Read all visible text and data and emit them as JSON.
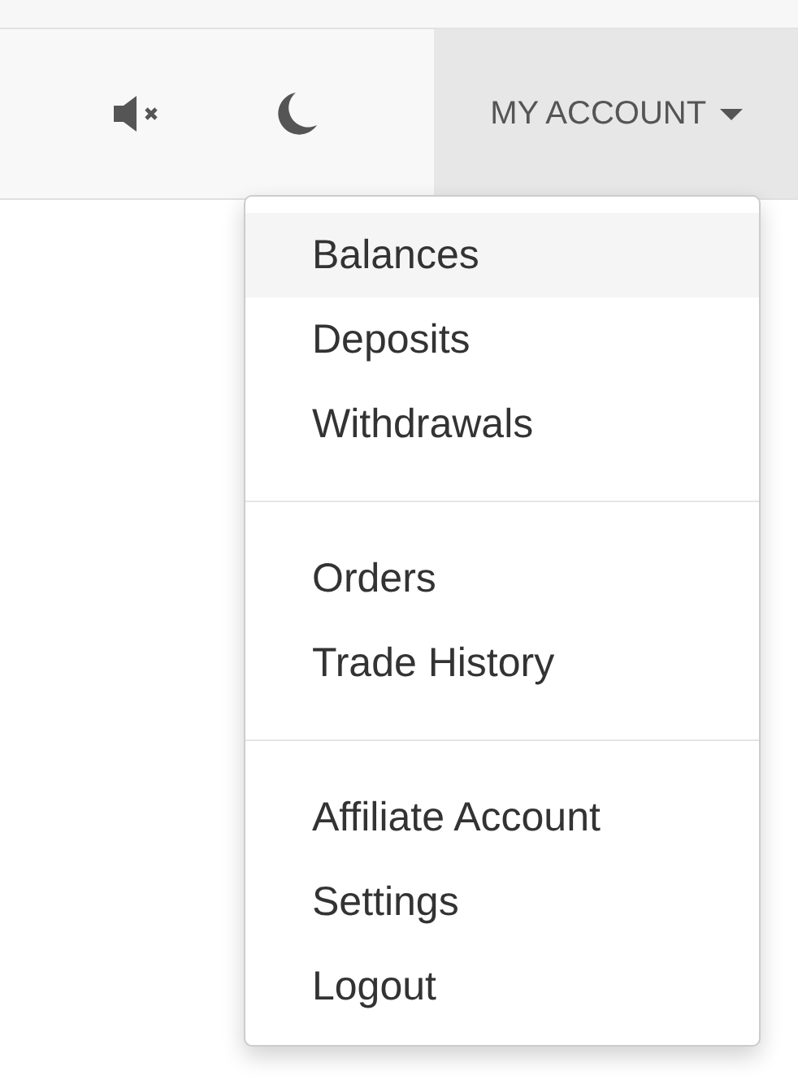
{
  "toolbar": {
    "sound_muted": true,
    "account_button": {
      "label": "MY ACCOUNT",
      "expanded": true
    }
  },
  "dropdown": {
    "groups": [
      {
        "items": [
          {
            "label": "Balances",
            "selected": true
          },
          {
            "label": "Deposits",
            "selected": false
          },
          {
            "label": "Withdrawals",
            "selected": false
          }
        ]
      },
      {
        "items": [
          {
            "label": "Orders",
            "selected": false
          },
          {
            "label": "Trade History",
            "selected": false
          }
        ]
      },
      {
        "items": [
          {
            "label": "Affiliate Account",
            "selected": false
          },
          {
            "label": "Settings",
            "selected": false
          },
          {
            "label": "Logout",
            "selected": false
          }
        ]
      }
    ]
  }
}
